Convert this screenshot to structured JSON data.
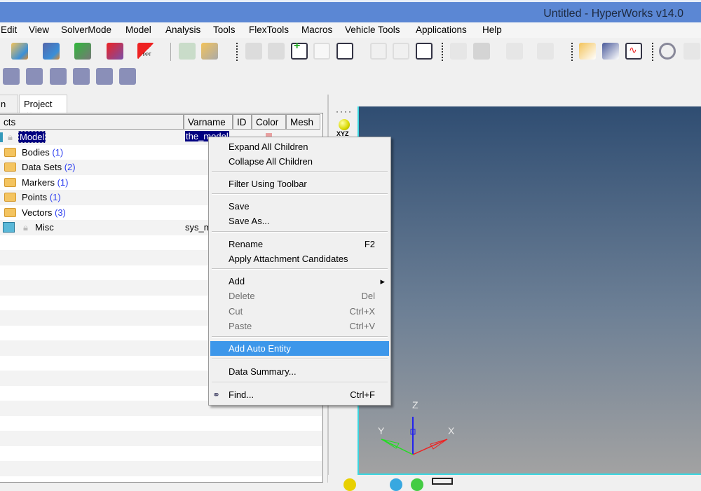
{
  "window": {
    "title": "Untitled - HyperWorks v14.0"
  },
  "menubar": [
    "Edit",
    "View",
    "SolverMode",
    "Model",
    "Analysis",
    "Tools",
    "FlexTools",
    "Macros",
    "Vehicle Tools",
    "Applications",
    "Help"
  ],
  "tabs": [
    {
      "label": "n"
    },
    {
      "label": "Project",
      "close": "×"
    }
  ],
  "tree": {
    "columns": [
      "cts",
      "Varname",
      "ID",
      "Color",
      "Mesh"
    ],
    "rows": [
      {
        "name": "Model",
        "varname": "the_model",
        "selected": true
      },
      {
        "name": "Bodies",
        "count": "(1)"
      },
      {
        "name": "Data Sets",
        "count": "(2)"
      },
      {
        "name": "Markers",
        "count": "(1)"
      },
      {
        "name": "Points",
        "count": "(1)"
      },
      {
        "name": "Vectors",
        "count": "(3)"
      },
      {
        "name": "Misc",
        "varname": "sys_m"
      }
    ]
  },
  "viewport": {
    "triad_label": "XYZ",
    "axes": {
      "x": "X",
      "y": "Y",
      "z": "Z"
    },
    "toolbar_labels": {
      "ppt": "PPT"
    }
  },
  "context_menu": {
    "items": [
      {
        "label": "Expand All Children"
      },
      {
        "label": "Collapse All Children"
      },
      {
        "label": "Filter Using Toolbar"
      },
      {
        "label": "Save"
      },
      {
        "label": "Save As..."
      },
      {
        "label": "Rename",
        "shortcut": "F2"
      },
      {
        "label": "Apply Attachment Candidates"
      },
      {
        "label": "Add",
        "submenu": "▸"
      },
      {
        "label": "Delete",
        "shortcut": "Del",
        "disabled": true
      },
      {
        "label": "Cut",
        "shortcut": "Ctrl+X",
        "disabled": true
      },
      {
        "label": "Paste",
        "shortcut": "Ctrl+V",
        "disabled": true
      },
      {
        "label": "Add Auto Entity",
        "highlighted": true
      },
      {
        "label": "Data Summary..."
      },
      {
        "label": "Find...",
        "shortcut": "Ctrl+F"
      }
    ]
  },
  "colors": {
    "titlebar": "#5b87d4",
    "highlight": "#3d97ea",
    "selection": "#000080",
    "viewport_edge": "#3ad6e0"
  }
}
